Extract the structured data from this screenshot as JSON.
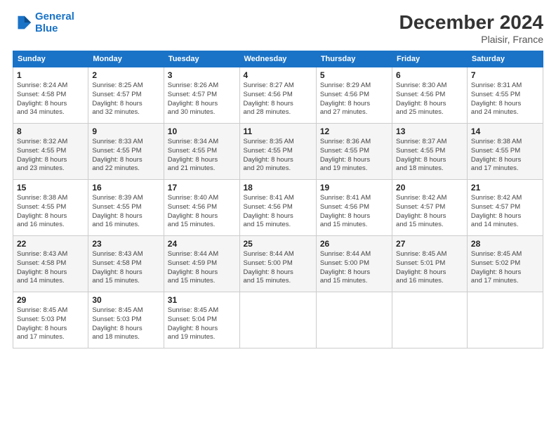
{
  "header": {
    "logo_line1": "General",
    "logo_line2": "Blue",
    "title": "December 2024",
    "subtitle": "Plaisir, France"
  },
  "days_of_week": [
    "Sunday",
    "Monday",
    "Tuesday",
    "Wednesday",
    "Thursday",
    "Friday",
    "Saturday"
  ],
  "weeks": [
    [
      {
        "day": "1",
        "info": "Sunrise: 8:24 AM\nSunset: 4:58 PM\nDaylight: 8 hours\nand 34 minutes."
      },
      {
        "day": "2",
        "info": "Sunrise: 8:25 AM\nSunset: 4:57 PM\nDaylight: 8 hours\nand 32 minutes."
      },
      {
        "day": "3",
        "info": "Sunrise: 8:26 AM\nSunset: 4:57 PM\nDaylight: 8 hours\nand 30 minutes."
      },
      {
        "day": "4",
        "info": "Sunrise: 8:27 AM\nSunset: 4:56 PM\nDaylight: 8 hours\nand 28 minutes."
      },
      {
        "day": "5",
        "info": "Sunrise: 8:29 AM\nSunset: 4:56 PM\nDaylight: 8 hours\nand 27 minutes."
      },
      {
        "day": "6",
        "info": "Sunrise: 8:30 AM\nSunset: 4:56 PM\nDaylight: 8 hours\nand 25 minutes."
      },
      {
        "day": "7",
        "info": "Sunrise: 8:31 AM\nSunset: 4:55 PM\nDaylight: 8 hours\nand 24 minutes."
      }
    ],
    [
      {
        "day": "8",
        "info": "Sunrise: 8:32 AM\nSunset: 4:55 PM\nDaylight: 8 hours\nand 23 minutes."
      },
      {
        "day": "9",
        "info": "Sunrise: 8:33 AM\nSunset: 4:55 PM\nDaylight: 8 hours\nand 22 minutes."
      },
      {
        "day": "10",
        "info": "Sunrise: 8:34 AM\nSunset: 4:55 PM\nDaylight: 8 hours\nand 21 minutes."
      },
      {
        "day": "11",
        "info": "Sunrise: 8:35 AM\nSunset: 4:55 PM\nDaylight: 8 hours\nand 20 minutes."
      },
      {
        "day": "12",
        "info": "Sunrise: 8:36 AM\nSunset: 4:55 PM\nDaylight: 8 hours\nand 19 minutes."
      },
      {
        "day": "13",
        "info": "Sunrise: 8:37 AM\nSunset: 4:55 PM\nDaylight: 8 hours\nand 18 minutes."
      },
      {
        "day": "14",
        "info": "Sunrise: 8:38 AM\nSunset: 4:55 PM\nDaylight: 8 hours\nand 17 minutes."
      }
    ],
    [
      {
        "day": "15",
        "info": "Sunrise: 8:38 AM\nSunset: 4:55 PM\nDaylight: 8 hours\nand 16 minutes."
      },
      {
        "day": "16",
        "info": "Sunrise: 8:39 AM\nSunset: 4:55 PM\nDaylight: 8 hours\nand 16 minutes."
      },
      {
        "day": "17",
        "info": "Sunrise: 8:40 AM\nSunset: 4:56 PM\nDaylight: 8 hours\nand 15 minutes."
      },
      {
        "day": "18",
        "info": "Sunrise: 8:41 AM\nSunset: 4:56 PM\nDaylight: 8 hours\nand 15 minutes."
      },
      {
        "day": "19",
        "info": "Sunrise: 8:41 AM\nSunset: 4:56 PM\nDaylight: 8 hours\nand 15 minutes."
      },
      {
        "day": "20",
        "info": "Sunrise: 8:42 AM\nSunset: 4:57 PM\nDaylight: 8 hours\nand 15 minutes."
      },
      {
        "day": "21",
        "info": "Sunrise: 8:42 AM\nSunset: 4:57 PM\nDaylight: 8 hours\nand 14 minutes."
      }
    ],
    [
      {
        "day": "22",
        "info": "Sunrise: 8:43 AM\nSunset: 4:58 PM\nDaylight: 8 hours\nand 14 minutes."
      },
      {
        "day": "23",
        "info": "Sunrise: 8:43 AM\nSunset: 4:58 PM\nDaylight: 8 hours\nand 15 minutes."
      },
      {
        "day": "24",
        "info": "Sunrise: 8:44 AM\nSunset: 4:59 PM\nDaylight: 8 hours\nand 15 minutes."
      },
      {
        "day": "25",
        "info": "Sunrise: 8:44 AM\nSunset: 5:00 PM\nDaylight: 8 hours\nand 15 minutes."
      },
      {
        "day": "26",
        "info": "Sunrise: 8:44 AM\nSunset: 5:00 PM\nDaylight: 8 hours\nand 15 minutes."
      },
      {
        "day": "27",
        "info": "Sunrise: 8:45 AM\nSunset: 5:01 PM\nDaylight: 8 hours\nand 16 minutes."
      },
      {
        "day": "28",
        "info": "Sunrise: 8:45 AM\nSunset: 5:02 PM\nDaylight: 8 hours\nand 17 minutes."
      }
    ],
    [
      {
        "day": "29",
        "info": "Sunrise: 8:45 AM\nSunset: 5:03 PM\nDaylight: 8 hours\nand 17 minutes."
      },
      {
        "day": "30",
        "info": "Sunrise: 8:45 AM\nSunset: 5:03 PM\nDaylight: 8 hours\nand 18 minutes."
      },
      {
        "day": "31",
        "info": "Sunrise: 8:45 AM\nSunset: 5:04 PM\nDaylight: 8 hours\nand 19 minutes."
      },
      null,
      null,
      null,
      null
    ]
  ]
}
